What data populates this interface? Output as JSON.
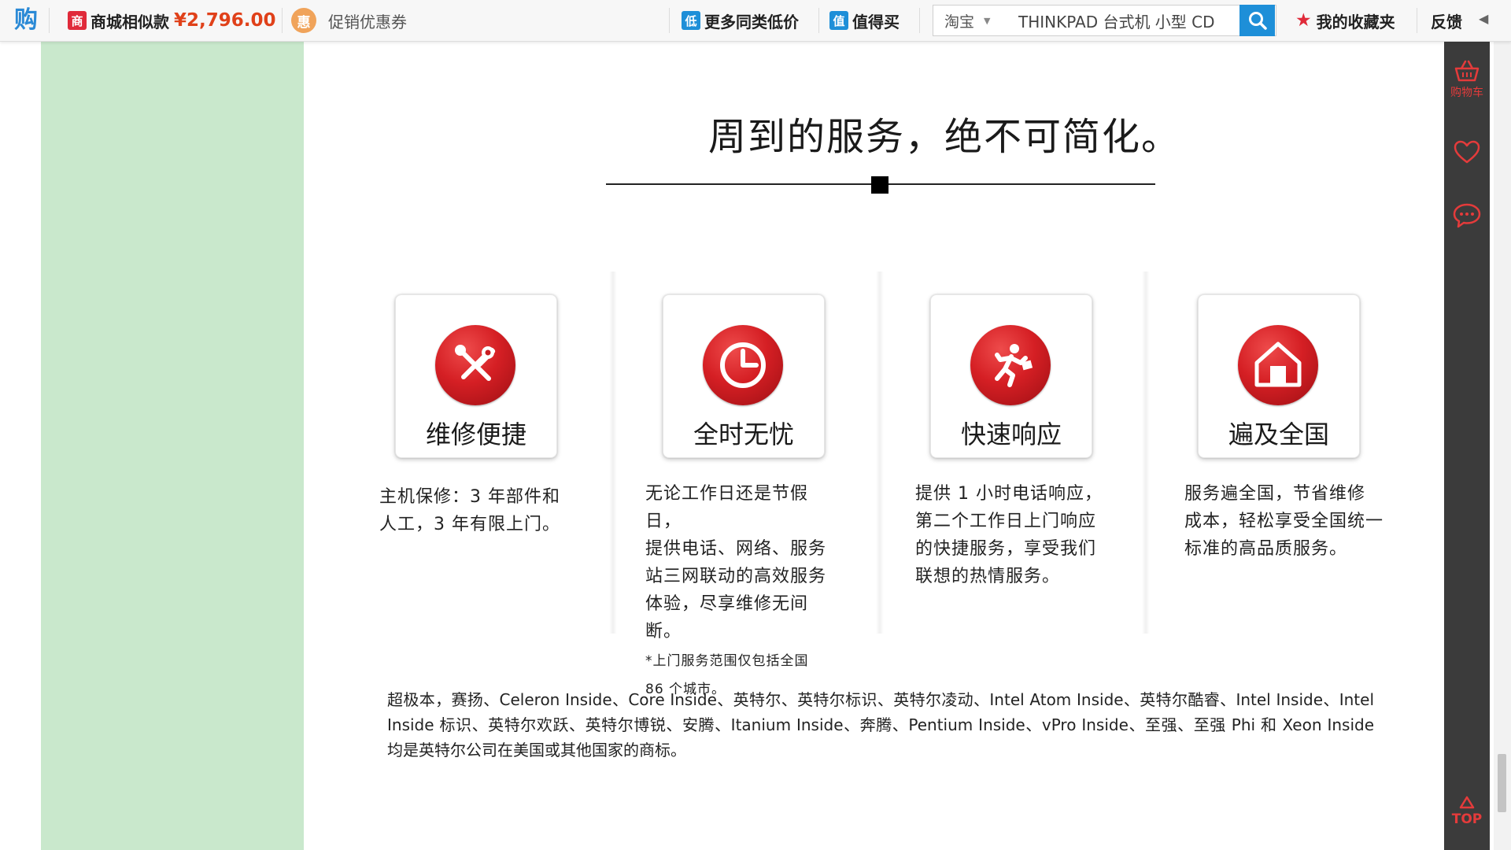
{
  "toolbar": {
    "logo_glyph": "购",
    "mall_badge": "商",
    "mall_label": "商城相似款",
    "mall_price": "¥2,796.00",
    "promo_badge": "惠",
    "promo_label": "促销优惠券",
    "low_badge": "低",
    "low_label": "更多同类低价",
    "worth_badge": "值",
    "worth_label": "值得买",
    "search": {
      "scope": "淘宝",
      "value": "THINKPAD 台式机 小型 CD"
    },
    "favorites_label": "我的收藏夹",
    "feedback_label": "反馈"
  },
  "sidebar": {
    "cart_label": "购物车",
    "top_label": "TOP"
  },
  "content": {
    "title": "周到的服务，绝不可简化。",
    "features": [
      {
        "icon": "tools-icon",
        "label": "维修便捷",
        "lines": [
          "主机保修：3 年部件和",
          "人工，3 年有限上门。"
        ]
      },
      {
        "icon": "clock-icon",
        "label": "全时无忧",
        "lines": [
          "无论工作日还是节假日，",
          "提供电话、网络、服务",
          "站三网联动的高效服务",
          "体验，尽享维修无间断。"
        ],
        "note_lines": [
          "*上门服务范围仅包括全国",
          "86 个城市。"
        ]
      },
      {
        "icon": "running-man-icon",
        "label": "快速响应",
        "lines": [
          "提供 1 小时电话响应，",
          "第二个工作日上门响应",
          "的快捷服务，享受我们",
          "联想的热情服务。"
        ]
      },
      {
        "icon": "house-icon",
        "label": "遍及全国",
        "lines": [
          "服务遍全国，节省维修",
          "成本，轻松享受全国统一",
          "标准的高品质服务。"
        ]
      }
    ],
    "legal_text": "超极本，赛扬、Celeron Inside、Core Inside、英特尔、英特尔标识、英特尔凌动、Intel Atom Inside、英特尔酷睿、Intel Inside、Intel Inside 标识、英特尔欢跃、英特尔博锐、安腾、Itanium Inside、奔腾、Pentium Inside、vPro Inside、至强、至强 Phi 和 Xeon Inside 均是英特尔公司在美国或其他国家的商标。"
  },
  "colors": {
    "accent_red": "#d51f24",
    "price_orange": "#e0411a",
    "link_blue": "#1e8fd8",
    "left_green": "#c9e8cc",
    "sidebar_dark": "#3b3b3b"
  }
}
